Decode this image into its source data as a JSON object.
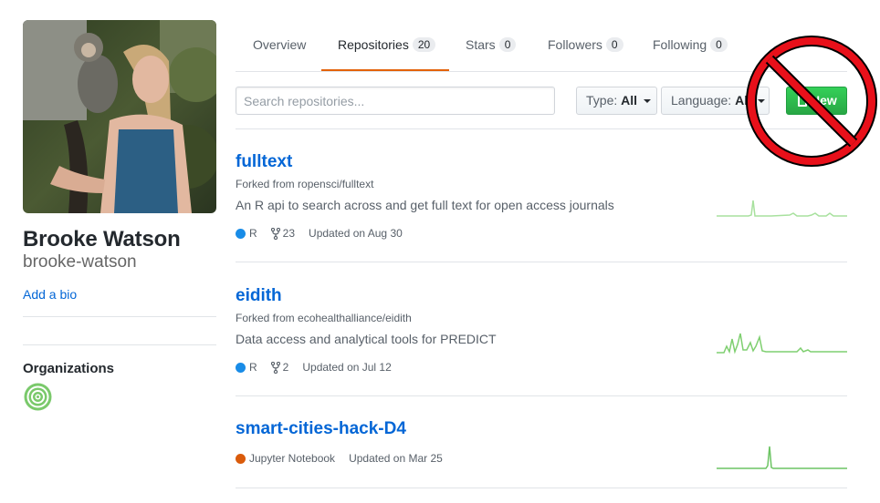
{
  "profile": {
    "name": "Brooke Watson",
    "login": "brooke-watson",
    "add_bio": "Add a bio",
    "organizations_heading": "Organizations"
  },
  "tabs": [
    {
      "label": "Overview",
      "count": null
    },
    {
      "label": "Repositories",
      "count": "20",
      "selected": true
    },
    {
      "label": "Stars",
      "count": "0"
    },
    {
      "label": "Followers",
      "count": "0"
    },
    {
      "label": "Following",
      "count": "0"
    }
  ],
  "filters": {
    "search_placeholder": "Search repositories...",
    "type_label": "Type:",
    "type_value": "All",
    "language_label": "Language:",
    "language_value": "All",
    "new_label": "New"
  },
  "repos": [
    {
      "name": "fulltext",
      "forked_prefix": "Forked from",
      "forked_from": "ropensci/fulltext",
      "description": "An R api to search across and get full text for open access journals",
      "language": "R",
      "language_color": "#198ce7",
      "forks": "23",
      "updated": "Updated on Aug 30"
    },
    {
      "name": "eidith",
      "forked_prefix": "Forked from",
      "forked_from": "ecohealthalliance/eidith",
      "description": "Data access and analytical tools for PREDICT",
      "language": "R",
      "language_color": "#198ce7",
      "forks": "2",
      "updated": "Updated on Jul 12"
    },
    {
      "name": "smart-cities-hack-D4",
      "language": "Jupyter Notebook",
      "language_color": "#da5b0b",
      "updated": "Updated on Mar 25"
    }
  ],
  "colors": {
    "link": "#0366d6",
    "tab_accent": "#e36209",
    "new_button": "#28a745",
    "no_sign": "#e8101a"
  },
  "icons": [
    "repo-book-icon",
    "fork-icon",
    "caret-down-icon",
    "prohibition-sign"
  ]
}
